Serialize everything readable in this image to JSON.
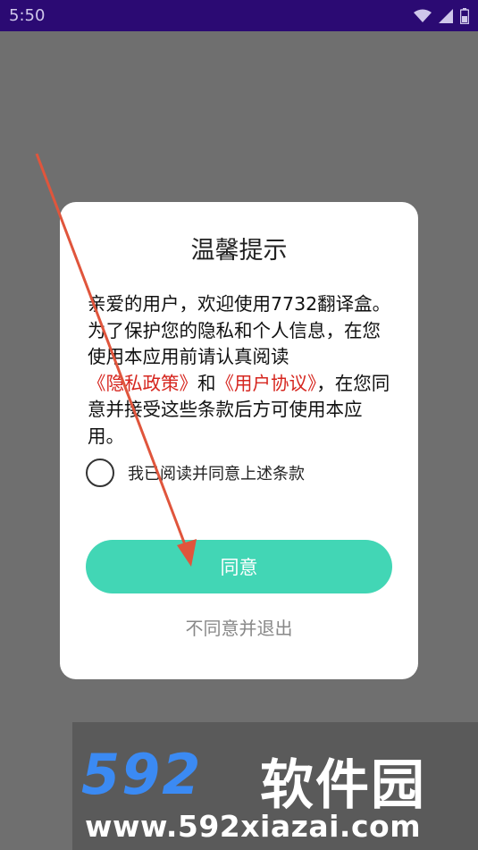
{
  "status_bar": {
    "time": "5:50",
    "icons": [
      "wifi-icon",
      "cell-signal-icon",
      "battery-icon"
    ]
  },
  "dialog": {
    "title": "温馨提示",
    "body": {
      "text_before": "亲爱的用户，欢迎使用7732翻译盒。为了保护您的隐私和个人信息，在您使用本应用前请认真阅读",
      "privacy_link": "《隐私政策》",
      "and": "和",
      "terms_link": "《用户协议》",
      "text_after": "，在您同意并接受这些条款后方可使用本应用。"
    },
    "checkbox_label": "我已阅读并同意上述条款",
    "checkbox_checked": false,
    "agree_button": "同意",
    "exit_link": "不同意并退出"
  },
  "colors": {
    "status_bar": "#2b0a73",
    "overlay": "#6f6f6f",
    "accent": "#42d6b5",
    "link": "#d6261f",
    "annotation_arrow": "#e0553c"
  },
  "watermark": {
    "logo": "592",
    "brand": "软件园",
    "url": "www.592xiazai.com"
  }
}
